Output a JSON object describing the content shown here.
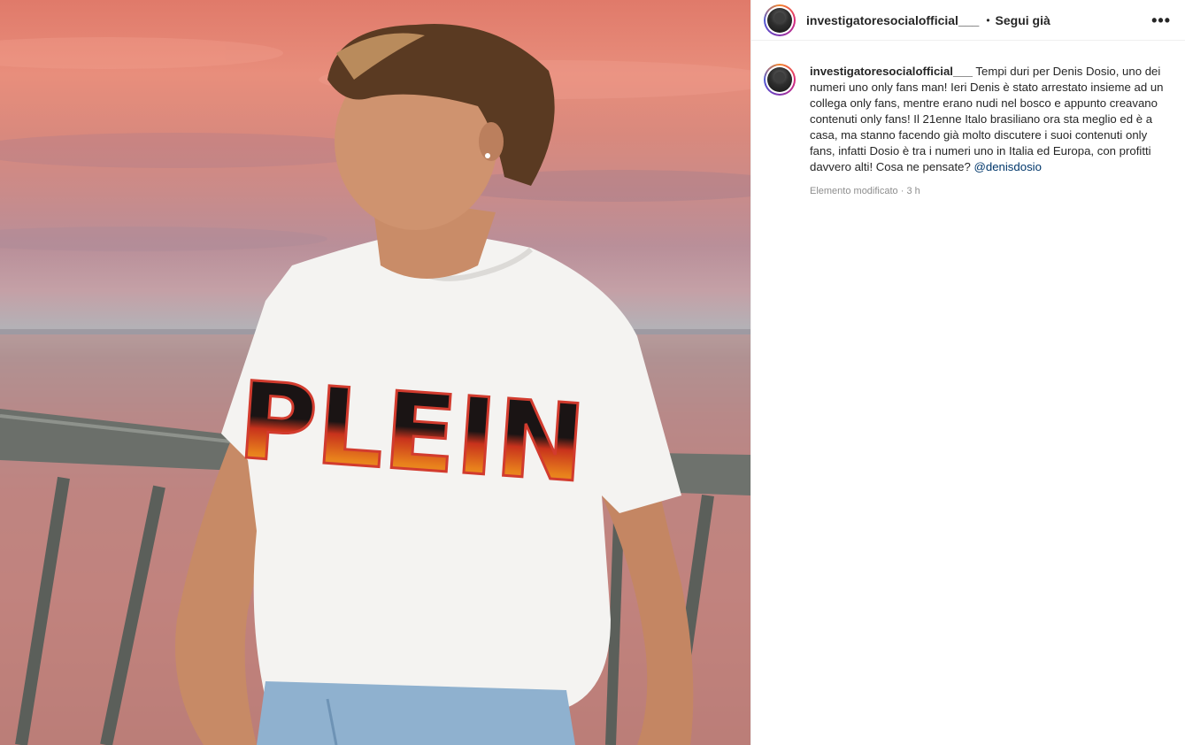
{
  "media": {
    "shirt_print": "PLEIN"
  },
  "header": {
    "username": "investigatoresocialofficial___",
    "separator": "•",
    "follow_label": "Segui già",
    "more_label": "•••"
  },
  "caption": {
    "username": "investigatoresocialofficial___",
    "text": "Tempi duri per Denis Dosio, uno dei numeri uno only fans man! Ieri Denis è stato arrestato insieme ad un collega only fans, mentre erano nudi nel bosco e appunto creavano contenuti only fans! Il 21enne Italo brasiliano ora sta meglio ed è a casa, ma stanno facendo già molto discutere i suoi contenuti only fans, infatti Dosio è tra i numeri uno in Italia ed Europa, con profitti davvero alti! Cosa ne pensate?",
    "mention": "@denisdosio",
    "edited_label": "Elemento modificato",
    "time_separator": "·",
    "time_ago": "3 h"
  },
  "colors": {
    "link": "#00376b",
    "muted": "#8e8e8e",
    "text": "#262626"
  }
}
